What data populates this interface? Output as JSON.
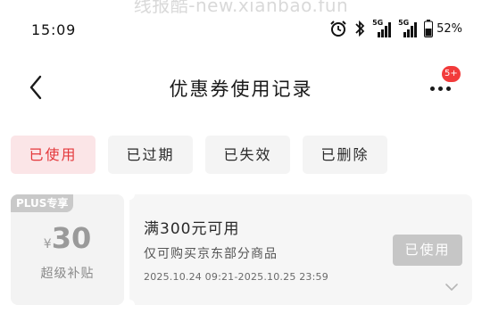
{
  "watermark": "线报酷-new.xianbao.fun",
  "status_bar": {
    "time": "15:09",
    "network_1": "5G",
    "network_2": "5G",
    "battery": "52%"
  },
  "header": {
    "title": "优惠券使用记录",
    "back_icon": "chevron-left-icon",
    "more_icon": "more-horizontal-icon",
    "more_badge": "5+"
  },
  "tabs": [
    {
      "label": "已使用",
      "active": true
    },
    {
      "label": "已过期",
      "active": false
    },
    {
      "label": "已失效",
      "active": false
    },
    {
      "label": "已删除",
      "active": false
    }
  ],
  "coupon": {
    "tag": "PLUS专享",
    "currency": "¥",
    "amount": "30",
    "subtitle": "超级补贴",
    "threshold": "满300元可用",
    "scope": "仅可购买京东部分商品",
    "validity": "2025.10.24 09:21-2025.10.25 23:59",
    "status_label": "已使用",
    "expand_icon": "chevron-down-icon"
  },
  "colors": {
    "accent": "#e4393c",
    "badge": "#f23b3b",
    "tab_active_bg": "#fbe5e7",
    "disabled_button": "#c6c6c6"
  }
}
